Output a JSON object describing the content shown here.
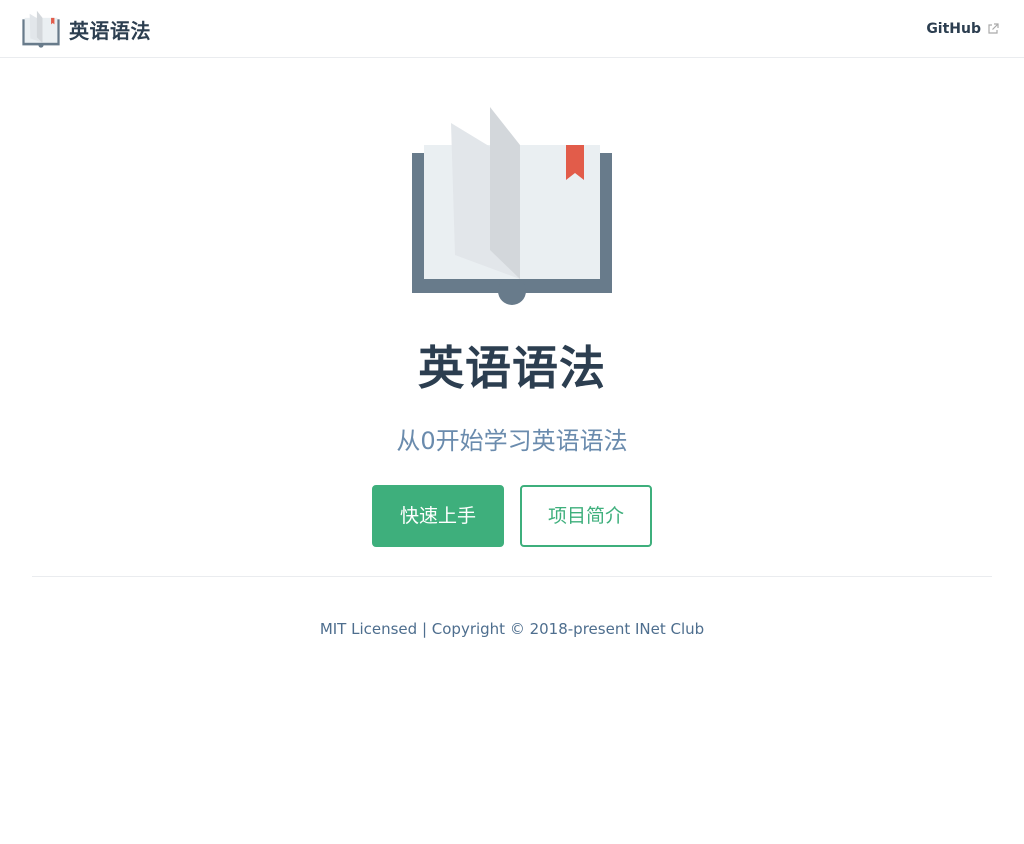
{
  "navbar": {
    "site_title": "英语语法",
    "links": [
      {
        "label": "GitHub",
        "external": true
      }
    ]
  },
  "hero": {
    "image_icon": "open-book-icon",
    "title": "英语语法",
    "description": "从0开始学习英语语法",
    "buttons": {
      "primary_label": "快速上手",
      "secondary_label": "项目简介"
    }
  },
  "footer": {
    "text": "MIT Licensed | Copyright © 2018-present INet Club"
  },
  "colors": {
    "accent": "#3eaf7c",
    "text": "#2c3e50",
    "description": "#6a8bad",
    "book_cover": "#687b8b",
    "book_page": "#eaeff2",
    "bookmark": "#e25c4a"
  }
}
